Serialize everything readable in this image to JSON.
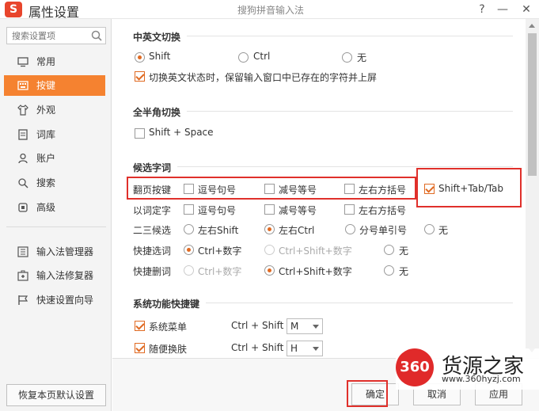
{
  "titlebar": {
    "logo": "S",
    "app_title": "属性设置",
    "window_title": "搜狗拼音输入法",
    "help": "?",
    "minimize": "—",
    "close": "✕"
  },
  "sidebar": {
    "search_placeholder": "搜索设置项",
    "items": [
      {
        "label": "常用",
        "icon": "monitor-icon"
      },
      {
        "label": "按键",
        "icon": "keyboard-icon",
        "active": true
      },
      {
        "label": "外观",
        "icon": "shirt-icon"
      },
      {
        "label": "词库",
        "icon": "book-icon"
      },
      {
        "label": "账户",
        "icon": "user-icon"
      },
      {
        "label": "搜索",
        "icon": "search-icon"
      },
      {
        "label": "高级",
        "icon": "advanced-icon"
      }
    ],
    "tools": [
      {
        "label": "输入法管理器",
        "icon": "manager-icon"
      },
      {
        "label": "输入法修复器",
        "icon": "repair-icon"
      },
      {
        "label": "快速设置向导",
        "icon": "wizard-flag-icon"
      }
    ],
    "restore_defaults": "恢复本页默认设置"
  },
  "sections": {
    "cn_en_switch": {
      "title": "中英文切换",
      "options": [
        "Shift",
        "Ctrl",
        "无"
      ],
      "selected": "Shift",
      "keep_text_label": "切换英文状态时，保留输入窗口中已存在的字符并上屏",
      "keep_text_checked": true
    },
    "full_half": {
      "title": "全半角切换",
      "shortcut_label": "Shift + Space",
      "checked": false
    },
    "candidates": {
      "title": "候选字词",
      "page_turn": {
        "label": "翻页按键",
        "options": [
          {
            "label": "逗号句号",
            "checked": false
          },
          {
            "label": "减号等号",
            "checked": false
          },
          {
            "label": "左右方括号",
            "checked": false
          },
          {
            "label": "Shift+Tab/Tab",
            "checked": true
          }
        ]
      },
      "word_to_char": {
        "label": "以词定字",
        "options": [
          {
            "label": "逗号句号",
            "checked": false
          },
          {
            "label": "减号等号",
            "checked": false
          },
          {
            "label": "左右方括号",
            "checked": false
          }
        ]
      },
      "second_third": {
        "label": "二三候选",
        "options": [
          {
            "label": "左右Shift",
            "checked": false
          },
          {
            "label": "左右Ctrl",
            "checked": true
          },
          {
            "label": "分号单引号",
            "checked": false
          },
          {
            "label": "无",
            "checked": false
          }
        ]
      },
      "quick_select": {
        "label": "快捷选词",
        "options": [
          {
            "label": "Ctrl+数字",
            "checked": true,
            "disabled": false
          },
          {
            "label": "Ctrl+Shift+数字",
            "checked": false,
            "disabled": true
          },
          {
            "label": "无",
            "checked": false,
            "disabled": false
          }
        ]
      },
      "quick_delete": {
        "label": "快捷删词",
        "options": [
          {
            "label": "Ctrl+数字",
            "checked": false,
            "disabled": true
          },
          {
            "label": "Ctrl+Shift+数字",
            "checked": true,
            "disabled": false
          },
          {
            "label": "无",
            "checked": false,
            "disabled": false
          }
        ]
      }
    },
    "system_shortcuts": {
      "title": "系统功能快捷键",
      "rows": [
        {
          "label": "系统菜单",
          "checked": true,
          "combo": "Ctrl + Shift +",
          "key": "M"
        },
        {
          "label": "随便换肤",
          "checked": true,
          "combo": "Ctrl + Shift +",
          "key": "H"
        }
      ]
    }
  },
  "buttons": {
    "ok": "确定",
    "cancel": "取消",
    "apply": "应用"
  },
  "watermark": {
    "logo": "360",
    "text": "货源之家",
    "url": "www.360hyzj.com"
  }
}
